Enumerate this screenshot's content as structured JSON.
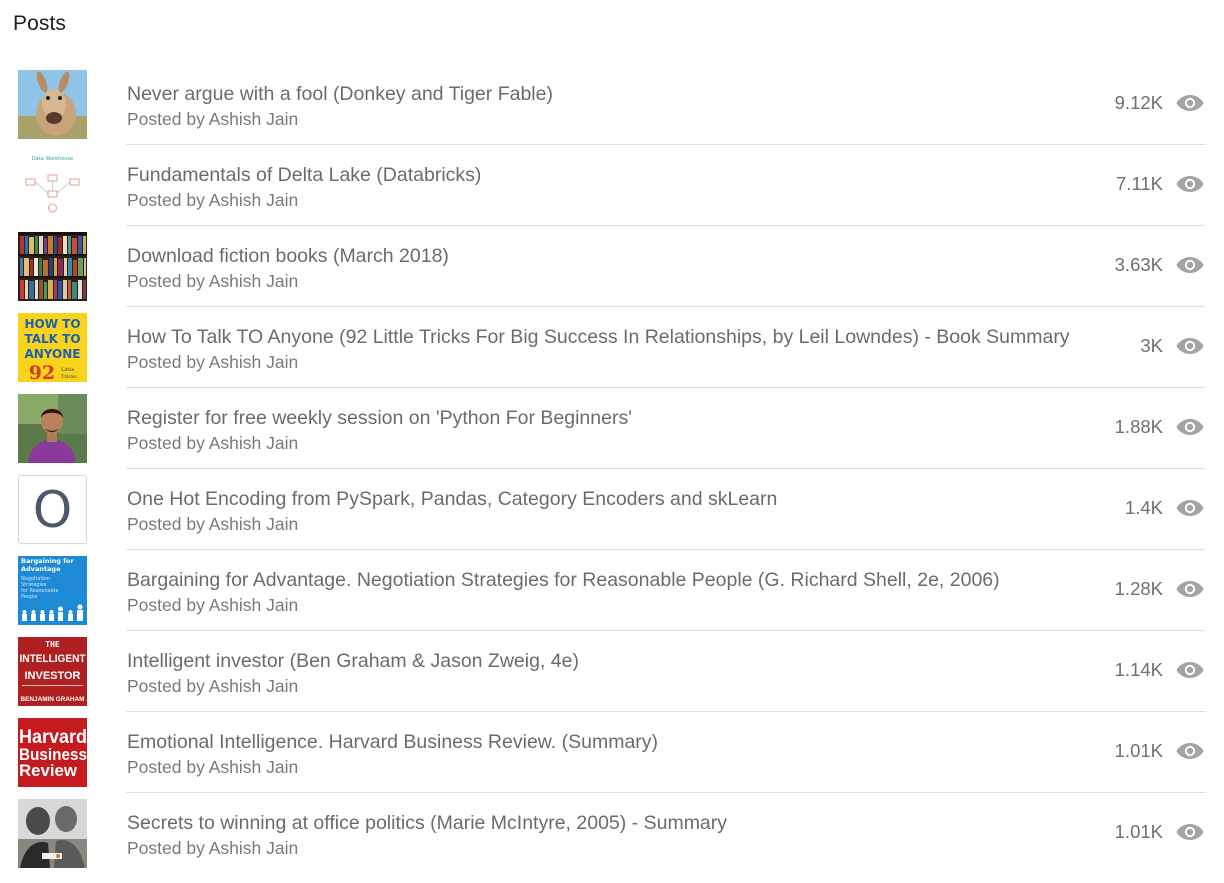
{
  "header": {
    "title": "Posts"
  },
  "icons": {
    "views": "eye-icon"
  },
  "colors": {
    "title_text": "#6b6b6b",
    "divider": "#dedede",
    "eye_icon": "#a4a4a4"
  },
  "posts": [
    {
      "title": "Never argue with a fool (Donkey and Tiger Fable)",
      "author": "Posted by Ashish Jain",
      "views": "9.12K",
      "thumbnail": "donkey-photo"
    },
    {
      "title": "Fundamentals of Delta Lake (Databricks)",
      "author": "Posted by Ashish Jain",
      "views": "7.11K",
      "thumbnail": "data-warehouse-diagram",
      "thumbnail_text": "Data Warehouse"
    },
    {
      "title": "Download fiction books (March 2018)",
      "author": "Posted by Ashish Jain",
      "views": "3.63K",
      "thumbnail": "bookshelf-photo"
    },
    {
      "title": "How To Talk TO Anyone (92 Little Tricks For Big Success In Relationships, by Leil Lowndes) - Book Summary",
      "author": "Posted by Ashish Jain",
      "views": "3K",
      "thumbnail": "book-cover-how-to-talk",
      "thumbnail_text": [
        "HOW TO",
        "TALK TO",
        "ANYONE",
        "92",
        "Little",
        "Tricks"
      ]
    },
    {
      "title": "Register for free weekly session on 'Python For Beginners'",
      "author": "Posted by Ashish Jain",
      "views": "1.88K",
      "thumbnail": "person-photo"
    },
    {
      "title": "One Hot Encoding from PySpark, Pandas, Category Encoders and skLearn",
      "author": "Posted by Ashish Jain",
      "views": "1.4K",
      "thumbnail": "letter-placeholder",
      "thumbnail_text": "O"
    },
    {
      "title": "Bargaining for Advantage. Negotiation Strategies for Reasonable People (G. Richard Shell, 2e, 2006)",
      "author": "Posted by Ashish Jain",
      "views": "1.28K",
      "thumbnail": "book-cover-bargaining",
      "thumbnail_text": [
        "Bargaining for",
        "Advantage",
        "Negotiation",
        "Strategies",
        "for Reasonable",
        "People"
      ]
    },
    {
      "title": "Intelligent investor (Ben Graham & Jason Zweig, 4e)",
      "author": "Posted by Ashish Jain",
      "views": "1.14K",
      "thumbnail": "book-cover-intelligent-investor",
      "thumbnail_text": [
        "THE",
        "INTELLIGENT",
        "INVESTOR",
        "BENJAMIN GRAHAM"
      ]
    },
    {
      "title": "Emotional Intelligence. Harvard Business Review. (Summary)",
      "author": "Posted by Ashish Jain",
      "views": "1.01K",
      "thumbnail": "book-cover-hbr",
      "thumbnail_text": [
        "Harvard",
        "Business",
        "Review"
      ]
    },
    {
      "title": "Secrets to winning at office politics (Marie McIntyre, 2005) - Summary",
      "author": "Posted by Ashish Jain",
      "views": "1.01K",
      "thumbnail": "office-photo"
    }
  ]
}
